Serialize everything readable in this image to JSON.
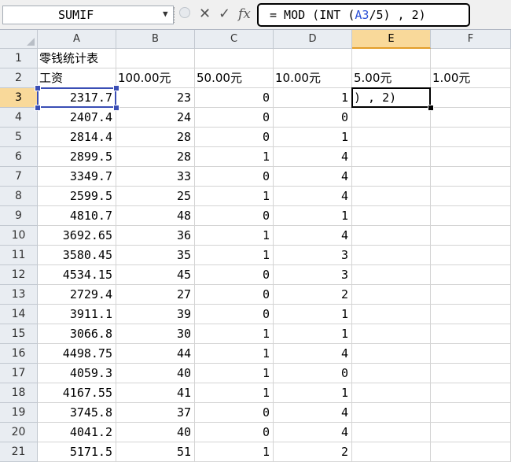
{
  "formula_bar": {
    "name_box": "SUMIF",
    "formula_parts": [
      {
        "text": "= MOD (INT (",
        "ref": false
      },
      {
        "text": "A3",
        "ref": true
      },
      {
        "text": "/5) , 2)",
        "ref": false
      }
    ],
    "cancel_glyph": "✕",
    "enter_glyph": "✓",
    "fx_glyph": "fx"
  },
  "columns": [
    "A",
    "B",
    "C",
    "D",
    "E",
    "F"
  ],
  "selected_column": "E",
  "selected_row": 3,
  "editing_cell_text": ") , 2)",
  "rows": [
    {
      "n": "1",
      "cells": [
        "零钱统计表",
        "",
        "",
        "",
        "",
        ""
      ]
    },
    {
      "n": "2",
      "cells": [
        "工资",
        "100.00元",
        "50.00元",
        "10.00元",
        "5.00元",
        "1.00元"
      ]
    },
    {
      "n": "3",
      "cells": [
        "2317.7",
        "23",
        "0",
        "1",
        "",
        ""
      ]
    },
    {
      "n": "4",
      "cells": [
        "2407.4",
        "24",
        "0",
        "0",
        "",
        ""
      ]
    },
    {
      "n": "5",
      "cells": [
        "2814.4",
        "28",
        "0",
        "1",
        "",
        ""
      ]
    },
    {
      "n": "6",
      "cells": [
        "2899.5",
        "28",
        "1",
        "4",
        "",
        ""
      ]
    },
    {
      "n": "7",
      "cells": [
        "3349.7",
        "33",
        "0",
        "4",
        "",
        ""
      ]
    },
    {
      "n": "8",
      "cells": [
        "2599.5",
        "25",
        "1",
        "4",
        "",
        ""
      ]
    },
    {
      "n": "9",
      "cells": [
        "4810.7",
        "48",
        "0",
        "1",
        "",
        ""
      ]
    },
    {
      "n": "10",
      "cells": [
        "3692.65",
        "36",
        "1",
        "4",
        "",
        ""
      ]
    },
    {
      "n": "11",
      "cells": [
        "3580.45",
        "35",
        "1",
        "3",
        "",
        ""
      ]
    },
    {
      "n": "12",
      "cells": [
        "4534.15",
        "45",
        "0",
        "3",
        "",
        ""
      ]
    },
    {
      "n": "13",
      "cells": [
        "2729.4",
        "27",
        "0",
        "2",
        "",
        ""
      ]
    },
    {
      "n": "14",
      "cells": [
        "3911.1",
        "39",
        "0",
        "1",
        "",
        ""
      ]
    },
    {
      "n": "15",
      "cells": [
        "3066.8",
        "30",
        "1",
        "1",
        "",
        ""
      ]
    },
    {
      "n": "16",
      "cells": [
        "4498.75",
        "44",
        "1",
        "4",
        "",
        ""
      ]
    },
    {
      "n": "17",
      "cells": [
        "4059.3",
        "40",
        "1",
        "0",
        "",
        ""
      ]
    },
    {
      "n": "18",
      "cells": [
        "4167.55",
        "41",
        "1",
        "1",
        "",
        ""
      ]
    },
    {
      "n": "19",
      "cells": [
        "3745.8",
        "37",
        "0",
        "4",
        "",
        ""
      ]
    },
    {
      "n": "20",
      "cells": [
        "4041.2",
        "40",
        "0",
        "4",
        "",
        ""
      ]
    },
    {
      "n": "21",
      "cells": [
        "5171.5",
        "51",
        "1",
        "2",
        "",
        ""
      ]
    }
  ],
  "colors": {
    "selected_header": "#f9d99a",
    "ref_text": "#2b50d6",
    "a3_border": "#3a4eb5"
  }
}
